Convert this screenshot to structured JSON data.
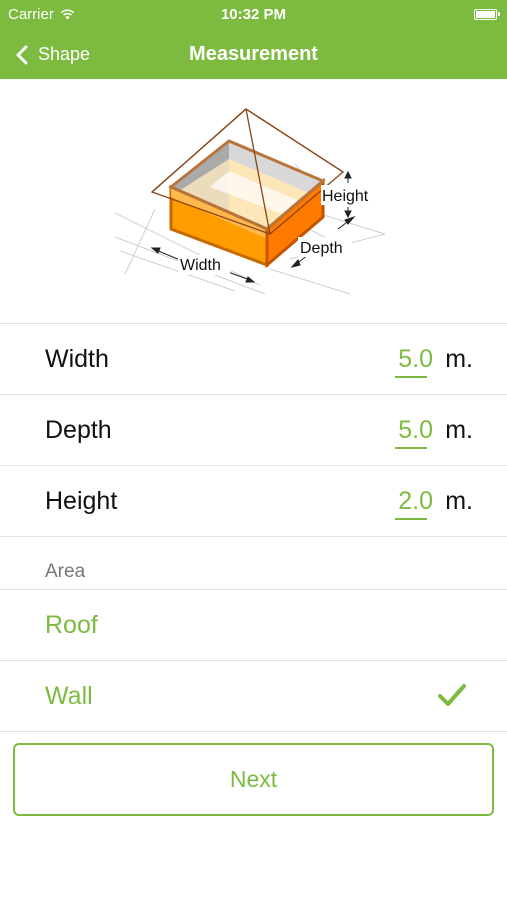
{
  "status_bar": {
    "carrier": "Carrier",
    "time": "10:32 PM"
  },
  "nav": {
    "back_label": "Shape",
    "title": "Measurement"
  },
  "illustration": {
    "width_label": "Width",
    "depth_label": "Depth",
    "height_label": "Height"
  },
  "measurements": [
    {
      "label": "Width",
      "value": "5.0",
      "unit": "m."
    },
    {
      "label": "Depth",
      "value": "5.0",
      "unit": "m."
    },
    {
      "label": "Height",
      "value": "2.0",
      "unit": "m."
    }
  ],
  "area": {
    "header": "Area",
    "options": [
      {
        "label": "Roof",
        "selected": false
      },
      {
        "label": "Wall",
        "selected": true
      }
    ]
  },
  "next_label": "Next",
  "colors": {
    "accent": "#7cbb3f",
    "box_front": "#ff9c00",
    "box_side": "#ff7a00",
    "roof_outline": "#8b4513"
  }
}
